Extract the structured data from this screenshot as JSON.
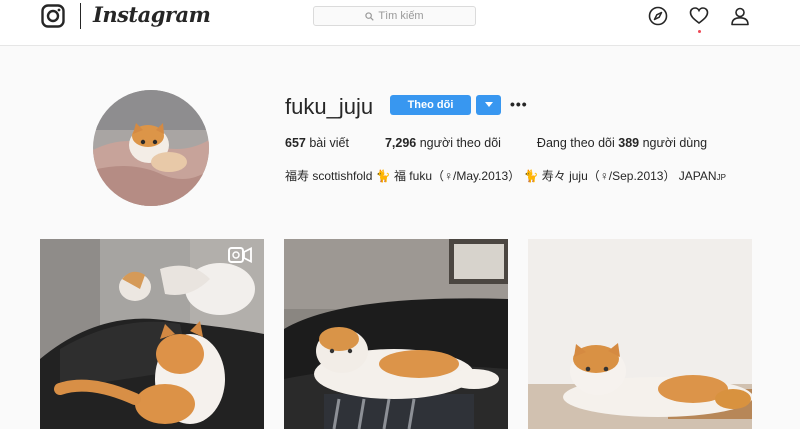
{
  "header": {
    "wordmark": "Instagram",
    "search_placeholder": "Tìm kiếm",
    "icons": [
      "instagram-logo-icon",
      "search-icon",
      "compass-icon",
      "heart-icon",
      "user-icon"
    ],
    "has_notification": true
  },
  "profile": {
    "username": "fuku_juju",
    "follow_label": "Theo dõi",
    "more_label": "•••",
    "stats": {
      "posts_count": "657",
      "posts_label": "bài viết",
      "followers_count": "7,296",
      "followers_label": "người theo dõi",
      "following_prefix": "Đang theo dõi",
      "following_count": "389",
      "following_suffix": "người dùng"
    },
    "bio": "福寿 scottishfold 🐈 福 fuku（♀/May.2013） 🐈 寿々 juju（♀/Sep.2013） JAPAN",
    "bio_suffix": "JP"
  },
  "posts": [
    {
      "type": "video",
      "description": "cat-on-sofa-video"
    },
    {
      "type": "photo",
      "description": "cat-lying-on-black-sofa"
    },
    {
      "type": "photo",
      "description": "cat-lying-on-floor"
    }
  ],
  "colors": {
    "accent": "#3897f0",
    "background": "#fafafa",
    "text": "#262626",
    "notification": "#ed4956"
  }
}
